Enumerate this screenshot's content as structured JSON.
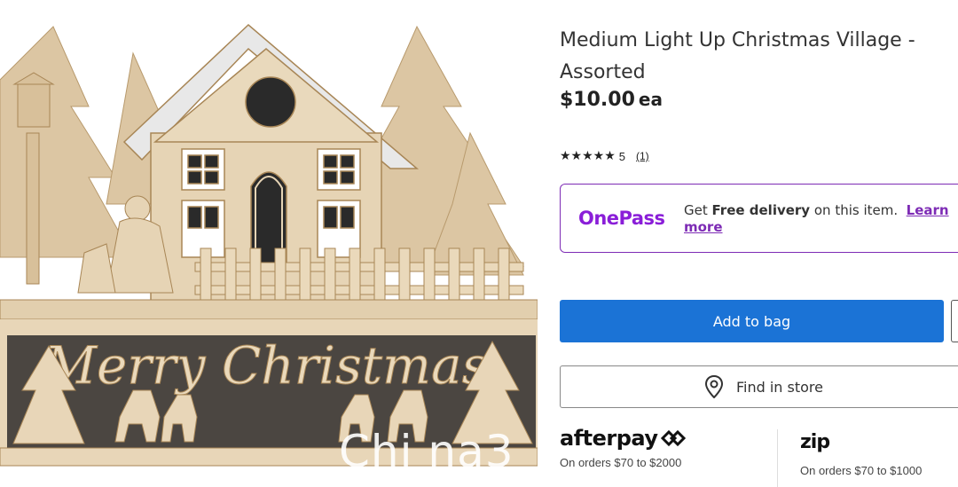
{
  "product": {
    "title": "Medium Light Up Christmas Village - Assorted",
    "price": "$10.00",
    "price_unit": "ea",
    "rating_value": "5",
    "review_count": "(1)",
    "stars": "★★★★★"
  },
  "image": {
    "carved_text": "Merry Christmas",
    "watermark": "Chi na3"
  },
  "onepass": {
    "logo": "OnePass",
    "text_prefix": "Get",
    "text_bold": "Free delivery",
    "text_suffix": "on this item.",
    "link": "Learn more",
    "brand_color": "#7d2bb5"
  },
  "actions": {
    "add_to_bag": "Add to bag",
    "find_in_store": "Find in store",
    "primary_color": "#1b73d6"
  },
  "payments": {
    "afterpay_logo": "afterpay",
    "afterpay_text": "On orders $70 to $2000",
    "zip_logo": "zip",
    "zip_text": "On orders $70 to $1000"
  }
}
